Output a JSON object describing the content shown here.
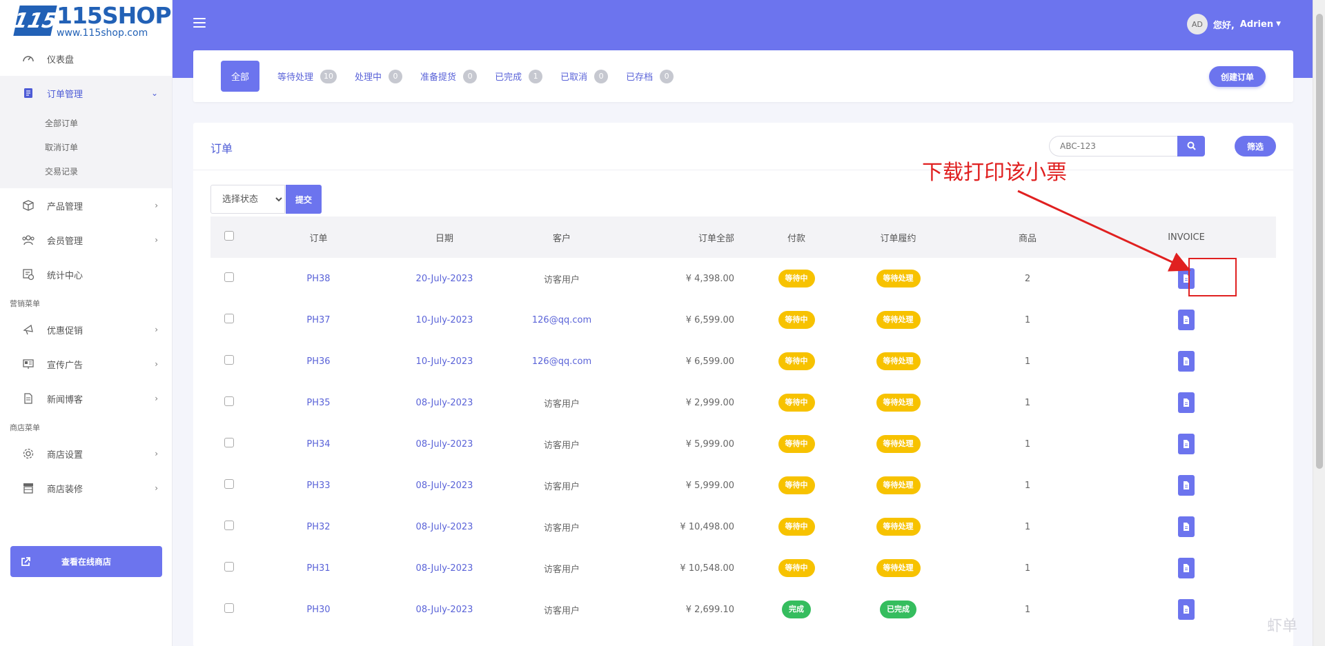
{
  "brand": {
    "title": "115SHOP",
    "url": "www.115shop.com",
    "mark": "115"
  },
  "sidebar": {
    "items": [
      {
        "label": "仪表盘"
      },
      {
        "label": "订单管理"
      },
      {
        "label": "产品管理"
      },
      {
        "label": "会员管理"
      },
      {
        "label": "统计中心"
      }
    ],
    "sub_items": [
      "全部订单",
      "取消订单",
      "交易记录"
    ],
    "marketing_title": "营销菜单",
    "marketing_items": [
      {
        "label": "优惠促销"
      },
      {
        "label": "宣传广告"
      },
      {
        "label": "新闻博客"
      }
    ],
    "shop_title": "商店菜单",
    "shop_items": [
      {
        "label": "商店设置"
      },
      {
        "label": "商店装修"
      }
    ],
    "visit_shop": "查看在线商店"
  },
  "header": {
    "avatar": "AD",
    "greeting": "您好,",
    "username": "Adrien",
    "accent": "#6c74ee"
  },
  "tabs": [
    {
      "label": "全部"
    },
    {
      "label": "等待处理",
      "count": "10"
    },
    {
      "label": "处理中",
      "count": "0"
    },
    {
      "label": "准备提货",
      "count": "0"
    },
    {
      "label": "已完成",
      "count": "1"
    },
    {
      "label": "已取消",
      "count": "0"
    },
    {
      "label": "已存档",
      "count": "0"
    }
  ],
  "create_order": "创建订单",
  "orders": {
    "title": "订单",
    "search_placeholder": "ABC-123",
    "filter": "筛选",
    "status_select": "选择状态",
    "submit": "提交",
    "columns": [
      "订单",
      "日期",
      "客户",
      "订单全部",
      "付款",
      "订单履约",
      "商品",
      "INVOICE"
    ],
    "rows": [
      {
        "id": "PH38",
        "date": "20-July-2023",
        "customer": "访客用户",
        "total": "¥ 4,398.00",
        "payment": "等待中",
        "fulfillment": "等待处理",
        "items": "2"
      },
      {
        "id": "PH37",
        "date": "10-July-2023",
        "customer": "126@qq.com",
        "total": "¥ 6,599.00",
        "payment": "等待中",
        "fulfillment": "等待处理",
        "items": "1"
      },
      {
        "id": "PH36",
        "date": "10-July-2023",
        "customer": "126@qq.com",
        "total": "¥ 6,599.00",
        "payment": "等待中",
        "fulfillment": "等待处理",
        "items": "1"
      },
      {
        "id": "PH35",
        "date": "08-July-2023",
        "customer": "访客用户",
        "total": "¥ 2,999.00",
        "payment": "等待中",
        "fulfillment": "等待处理",
        "items": "1"
      },
      {
        "id": "PH34",
        "date": "08-July-2023",
        "customer": "访客用户",
        "total": "¥ 5,999.00",
        "payment": "等待中",
        "fulfillment": "等待处理",
        "items": "1"
      },
      {
        "id": "PH33",
        "date": "08-July-2023",
        "customer": "访客用户",
        "total": "¥ 5,999.00",
        "payment": "等待中",
        "fulfillment": "等待处理",
        "items": "1"
      },
      {
        "id": "PH32",
        "date": "08-July-2023",
        "customer": "访客用户",
        "total": "¥ 10,498.00",
        "payment": "等待中",
        "fulfillment": "等待处理",
        "items": "1"
      },
      {
        "id": "PH31",
        "date": "08-July-2023",
        "customer": "访客用户",
        "total": "¥ 10,548.00",
        "payment": "等待中",
        "fulfillment": "等待处理",
        "items": "1"
      },
      {
        "id": "PH30",
        "date": "08-July-2023",
        "customer": "访客用户",
        "total": "¥ 2,699.10",
        "payment": "完成",
        "fulfillment": "已完成",
        "items": "1"
      }
    ]
  },
  "annotation": {
    "text": "下载打印该小票",
    "color": "#e02020"
  },
  "watermark": "虾单"
}
